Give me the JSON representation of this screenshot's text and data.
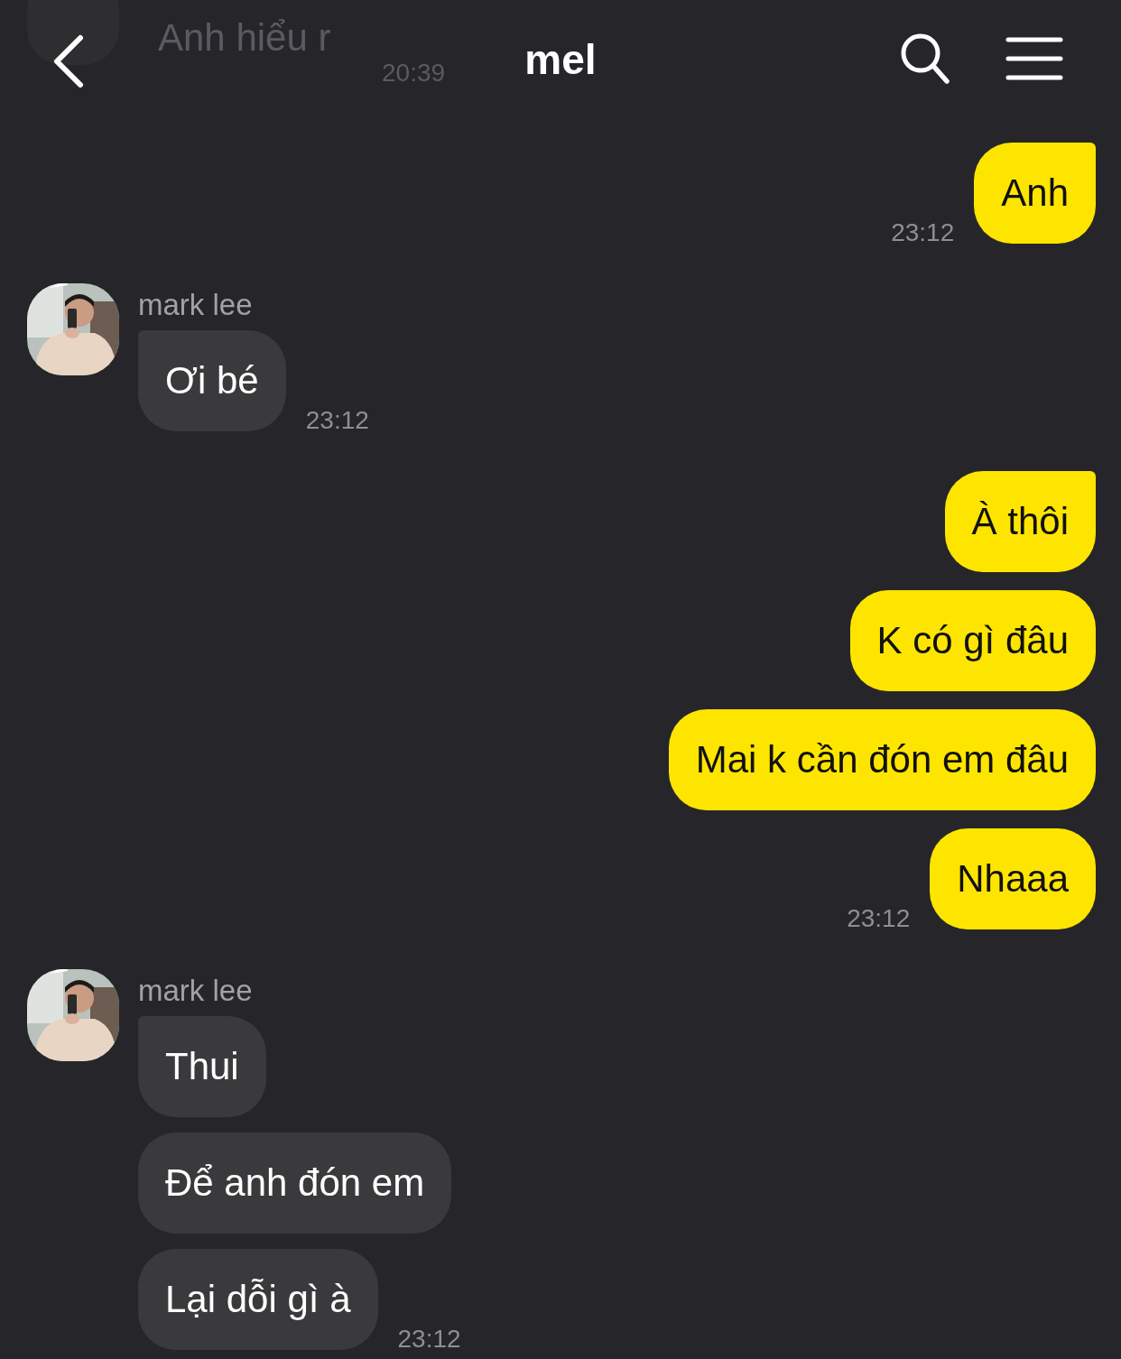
{
  "header": {
    "title": "mel"
  },
  "faded_message": {
    "text": "Anh hiểu r",
    "time": "20:39"
  },
  "groups": [
    {
      "kind": "sent",
      "messages": [
        "Anh"
      ],
      "time": "23:12"
    },
    {
      "kind": "received",
      "sender": "mark lee",
      "messages": [
        "Ơi bé"
      ],
      "time": "23:12"
    },
    {
      "kind": "sent",
      "messages": [
        "À thôi",
        "K có gì đâu",
        "Mai k cần đón em đâu",
        "Nhaaa"
      ],
      "time": "23:12"
    },
    {
      "kind": "received",
      "sender": "mark lee",
      "messages": [
        "Thui",
        "Để anh đón em",
        "Lại dỗi gì à"
      ],
      "time": "23:12"
    }
  ]
}
